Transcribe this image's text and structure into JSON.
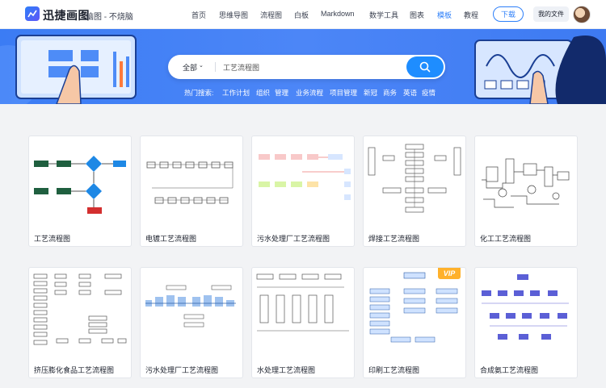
{
  "header": {
    "logo_name": "迅捷画图",
    "logo_slogan": "脑图 - 不烧脑",
    "nav": [
      {
        "label": "首页"
      },
      {
        "label": "思维导图"
      },
      {
        "label": "流程图"
      },
      {
        "label": "白板"
      },
      {
        "label": "Markdown"
      },
      {
        "label": "数学工具"
      },
      {
        "label": "图表"
      },
      {
        "label": "模板",
        "active": true
      },
      {
        "label": "教程"
      }
    ],
    "download_label": "下载",
    "my_files_label": "我的文件"
  },
  "search": {
    "scope": "全部",
    "value": "工艺流程图"
  },
  "hot": {
    "label": "热门搜索:",
    "items": [
      "工作计划",
      "组织",
      "管理",
      "业务流程",
      "项目管理",
      "新冠",
      "商务",
      "英语",
      "疫情"
    ]
  },
  "templates": [
    {
      "title": "工艺流程图",
      "vip": false
    },
    {
      "title": "电镀工艺流程图",
      "vip": false
    },
    {
      "title": "污水处理厂工艺流程图",
      "vip": false
    },
    {
      "title": "焊接工艺流程图",
      "vip": false
    },
    {
      "title": "化工工艺流程图",
      "vip": false
    },
    {
      "title": "挤压膨化食品工艺流程图",
      "vip": false
    },
    {
      "title": "污水处理厂工艺流程图",
      "vip": false
    },
    {
      "title": "水处理工艺流程图",
      "vip": false
    },
    {
      "title": "印刷工艺流程图",
      "vip": true
    },
    {
      "title": "合成氨工艺流程图",
      "vip": false
    }
  ],
  "vip_label": "VIP",
  "colors": {
    "brand": "#2d7ff9",
    "banner": "#3b7cf4",
    "vip": "#ffb12b"
  }
}
